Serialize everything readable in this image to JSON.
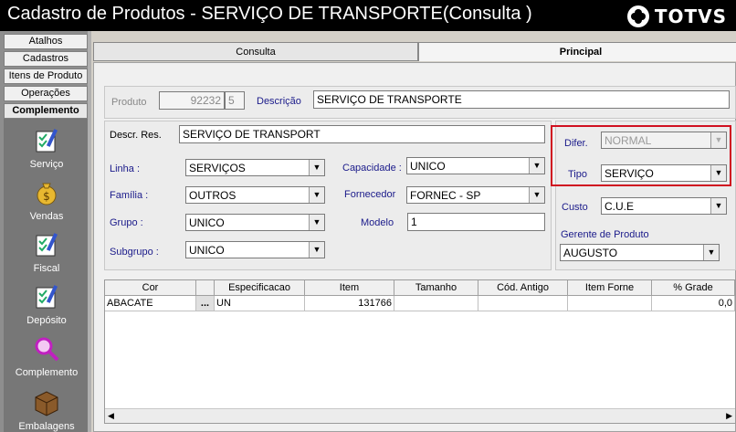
{
  "window": {
    "title": "Cadastro de Produtos  - SERVIÇO DE TRANSPORTE(Consulta )"
  },
  "brand": {
    "logo_text": "TOTVS"
  },
  "sidebar": {
    "nav": [
      "Atalhos",
      "Cadastros",
      "Itens de Produto",
      "Operações",
      "Complemento"
    ],
    "menu": [
      {
        "label": "Serviço",
        "icon": "checklist-icon"
      },
      {
        "label": "Vendas",
        "icon": "money-bag-icon"
      },
      {
        "label": "Fiscal",
        "icon": "checklist-icon"
      },
      {
        "label": "Depósito",
        "icon": "checklist-icon"
      },
      {
        "label": "Complemento",
        "icon": "magnifier-icon"
      },
      {
        "label": "Embalagens",
        "icon": "box-icon"
      }
    ]
  },
  "tabs": [
    {
      "label": "Consulta",
      "active": false
    },
    {
      "label": "Principal",
      "active": true
    }
  ],
  "form": {
    "produto": {
      "label": "Produto",
      "value": "92232",
      "digit": "5"
    },
    "descricao": {
      "label": "Descrição",
      "value": "SERVIÇO DE TRANSPORTE"
    },
    "descr_res": {
      "label": "Descr. Res.",
      "value": "SERVIÇO DE TRANSPORT"
    },
    "linha": {
      "label": "Linha :",
      "value": "SERVIÇOS"
    },
    "familia": {
      "label": "Família :",
      "value": "OUTROS"
    },
    "grupo": {
      "label": "Grupo :",
      "value": "UNICO"
    },
    "subgrupo": {
      "label": "Subgrupo :",
      "value": "UNICO"
    },
    "capacidade": {
      "label": "Capacidade :",
      "value": "UNICO"
    },
    "fornecedor": {
      "label": "Fornecedor",
      "value": "FORNEC - SP"
    },
    "modelo": {
      "label": "Modelo",
      "value": "1"
    },
    "difer": {
      "label": "Difer.",
      "value": "NORMAL"
    },
    "tipo": {
      "label": "Tipo",
      "value": "SERVIÇO"
    },
    "custo": {
      "label": "Custo",
      "value": "C.U.E"
    },
    "gerente": {
      "label": "Gerente de Produto",
      "value": "AUGUSTO"
    }
  },
  "grid": {
    "columns": [
      "Cor",
      "",
      "Especificacao",
      "Item",
      "Tamanho",
      "Cód. Antigo",
      "Item Forne",
      "% Grade"
    ],
    "rows": [
      [
        "ABACATE",
        "...",
        "UN",
        "131766",
        "",
        "",
        "",
        "0,0"
      ]
    ]
  },
  "colors": {
    "highlight": "#d01020",
    "label_blue": "#1a1a8a"
  }
}
